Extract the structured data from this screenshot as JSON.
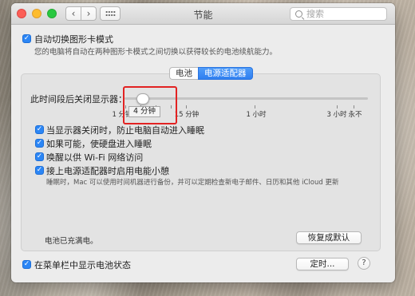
{
  "window": {
    "title": "节能",
    "search_placeholder": "搜索",
    "nav": {
      "back_glyph": "‹",
      "forward_glyph": "›"
    }
  },
  "auto_switch": {
    "checked": true,
    "label": "自动切换图形卡模式",
    "description": "您的电脑将自动在两种图形卡模式之间切换以获得较长的电池续航能力。"
  },
  "tabs": [
    {
      "label": "电池",
      "active": false
    },
    {
      "label": "电源适配器",
      "active": true
    }
  ],
  "display_sleep": {
    "label": "此时间段后关闭显示器：",
    "tooltip": "4 分钟",
    "ticks": [
      "1 分钟",
      "15 分钟",
      "1 小时",
      "3 小时",
      "永不"
    ]
  },
  "options": [
    {
      "label": "当显示器关闭时，防止电脑自动进入睡眠",
      "checked": true
    },
    {
      "label": "如果可能，使硬盘进入睡眠",
      "checked": true
    },
    {
      "label": "唤醒以供 Wi-Fi 网络访问",
      "checked": true
    },
    {
      "label": "接上电源适配器时启用电能小憩",
      "checked": true,
      "description": "睡眠时，Mac 可以使用时间机器进行备份，并可以定期检查新电子邮件、日历和其他 iCloud 更新"
    }
  ],
  "status_text": "电池已充满电。",
  "restore_defaults_label": "恢复成默认",
  "menu_bar_battery": {
    "label": "在菜单栏中显示电池状态",
    "checked": true
  },
  "schedule_label": "定时...",
  "help_glyph": "?",
  "checkmark_glyph": "✓",
  "colors": {
    "accent": "#2c86f5",
    "highlight": "#e22222"
  }
}
